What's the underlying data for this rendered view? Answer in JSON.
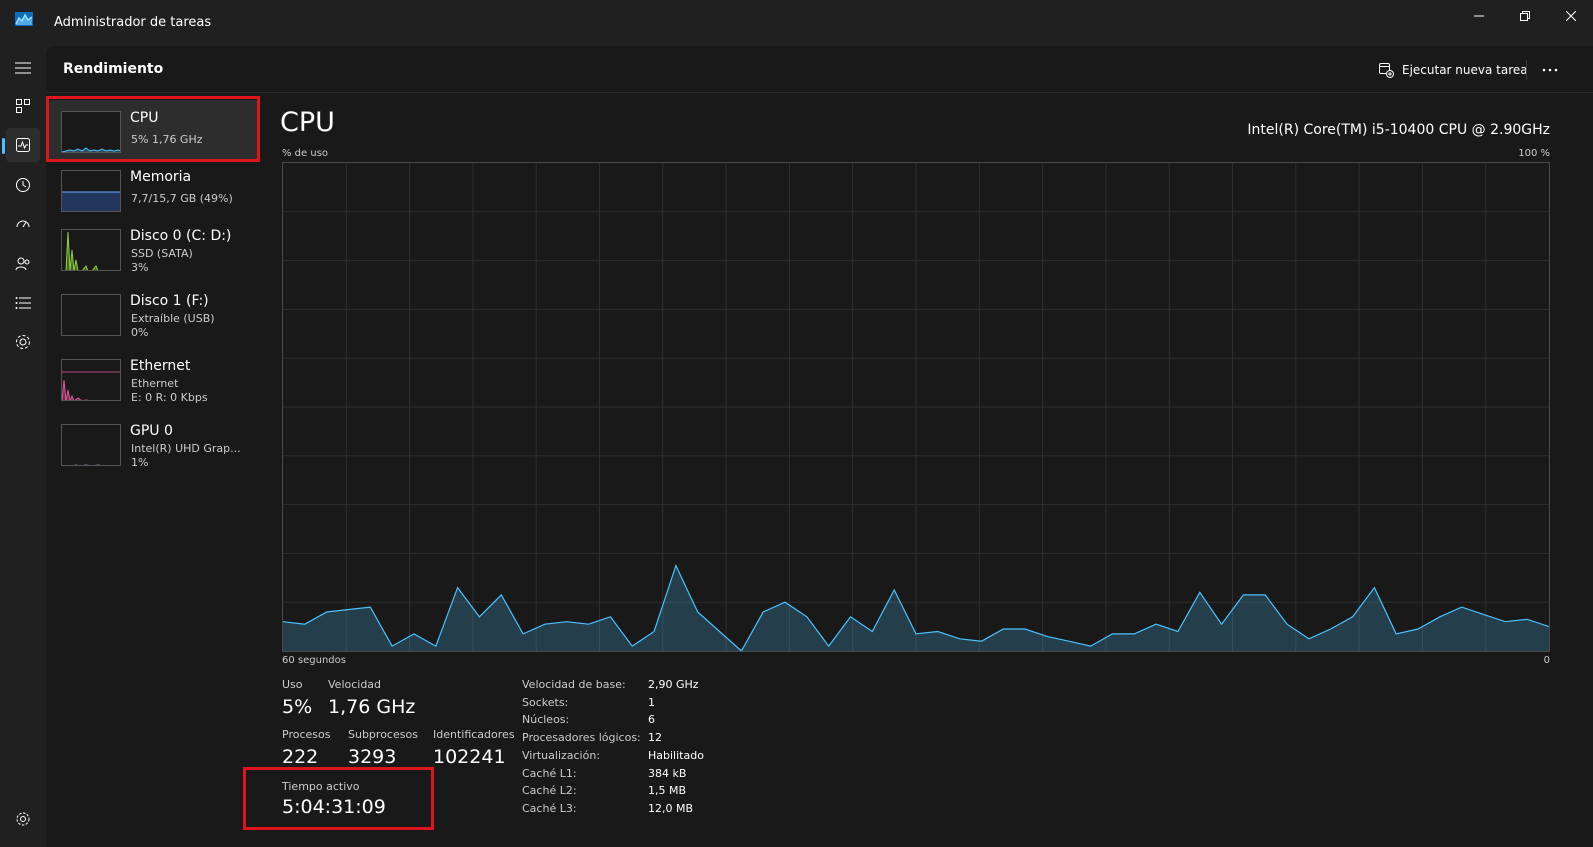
{
  "window": {
    "title": "Administrador de tareas"
  },
  "header": {
    "section_title": "Rendimiento",
    "run_task_label": "Ejecutar nueva tarea"
  },
  "nav": {
    "items": [
      "processes-icon",
      "performance-icon",
      "history-icon",
      "startup-icon",
      "users-icon",
      "details-icon",
      "services-icon"
    ],
    "active": "performance-icon",
    "settings_icon": "gear-icon"
  },
  "devices": [
    {
      "name": "CPU",
      "line1": "5%  1,76 GHz",
      "line2": "",
      "color": "#4cc2ff",
      "active": true
    },
    {
      "name": "Memoria",
      "line1": "7,7/15,7 GB (49%)",
      "line2": "",
      "color": "#6fa8ff",
      "active": false
    },
    {
      "name": "Disco 0 (C: D:)",
      "line1": "SSD (SATA)",
      "line2": "3%",
      "color": "#8fd13f",
      "active": false
    },
    {
      "name": "Disco 1 (F:)",
      "line1": "Extraíble (USB)",
      "line2": "0%",
      "color": "#8fd13f",
      "active": false
    },
    {
      "name": "Ethernet",
      "line1": "Ethernet",
      "line2": "E: 0 R: 0 Kbps",
      "color": "#e0579b",
      "active": false
    },
    {
      "name": "GPU 0",
      "line1": "Intel(R) UHD Grap...",
      "line2": "1%",
      "color": "#b07cd8",
      "active": false
    }
  ],
  "main": {
    "title": "CPU",
    "model": "Intel(R) Core(TM) i5-10400 CPU @ 2.90GHz",
    "graph_ylabel": "% de uso",
    "graph_ymax_label": "100 %",
    "graph_xleft_label": "60 segundos",
    "graph_xright_label": "0",
    "accent": "#4cc2ff"
  },
  "chart_data": {
    "type": "area",
    "x_range": [
      60,
      0
    ],
    "ylim": [
      0,
      100
    ],
    "grid": true,
    "values": [
      6,
      5.5,
      8,
      8.5,
      9,
      1,
      3.5,
      1,
      13,
      7,
      11.5,
      3.5,
      5.5,
      6,
      5.5,
      7,
      1,
      4,
      17.5,
      8,
      4,
      0,
      8,
      10,
      7,
      1,
      7,
      4,
      12.5,
      3.5,
      4,
      2.5,
      2,
      4.5,
      4.5,
      3,
      2,
      1,
      3.5,
      3.5,
      5.5,
      4,
      12,
      5.5,
      11.5,
      11.5,
      5.5,
      2.5,
      4.5,
      7,
      13,
      3.5,
      4.5,
      7,
      9,
      7.5,
      6,
      6.5,
      5
    ]
  },
  "stats": {
    "usage_label": "Uso",
    "usage_value": "5%",
    "speed_label": "Velocidad",
    "speed_value": "1,76 GHz",
    "processes_label": "Procesos",
    "processes_value": "222",
    "threads_label": "Subprocesos",
    "threads_value": "3293",
    "handles_label": "Identificadores",
    "handles_value": "102241",
    "uptime_label": "Tiempo activo",
    "uptime_value": "5:04:31:09"
  },
  "specs": [
    {
      "label": "Velocidad de base:",
      "value": "2,90 GHz"
    },
    {
      "label": "Sockets:",
      "value": "1"
    },
    {
      "label": "Núcleos:",
      "value": "6"
    },
    {
      "label": "Procesadores lógicos:",
      "value": "12"
    },
    {
      "label": "Virtualización:",
      "value": "Habilitado"
    },
    {
      "label": "Caché L1:",
      "value": "384 kB"
    },
    {
      "label": "Caché L2:",
      "value": "1,5 MB"
    },
    {
      "label": "Caché L3:",
      "value": "12,0 MB"
    }
  ]
}
